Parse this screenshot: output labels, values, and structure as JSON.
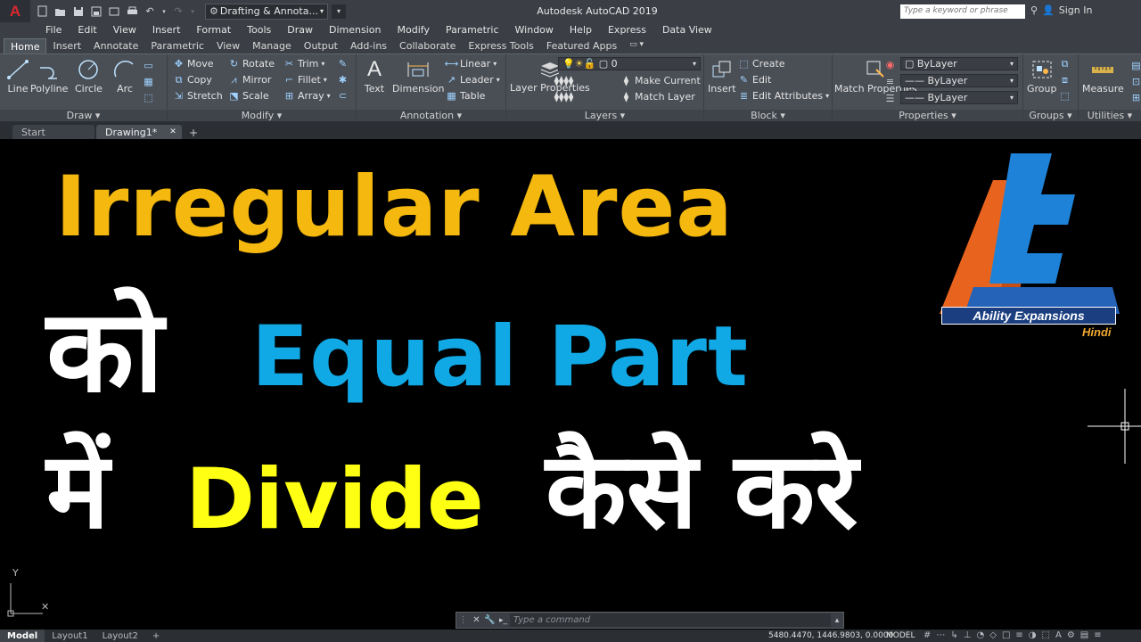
{
  "titlebar": {
    "logo": "A",
    "workspace": "Drafting & Annota...",
    "title": "Autodesk AutoCAD 2019",
    "search_placeholder": "Type a keyword or phrase",
    "signin": "Sign In"
  },
  "menu": [
    "File",
    "Edit",
    "View",
    "Insert",
    "Format",
    "Tools",
    "Draw",
    "Dimension",
    "Modify",
    "Parametric",
    "Window",
    "Help",
    "Express",
    "Data View"
  ],
  "ribbon_tabs": [
    "Home",
    "Insert",
    "Annotate",
    "Parametric",
    "View",
    "Manage",
    "Output",
    "Add-ins",
    "Collaborate",
    "Express Tools",
    "Featured Apps"
  ],
  "ribbon": {
    "draw": {
      "label": "Draw",
      "line": "Line",
      "polyline": "Polyline",
      "circle": "Circle",
      "arc": "Arc"
    },
    "modify": {
      "label": "Modify",
      "move": "Move",
      "rotate": "Rotate",
      "trim": "Trim",
      "copy": "Copy",
      "mirror": "Mirror",
      "fillet": "Fillet",
      "stretch": "Stretch",
      "scale": "Scale",
      "array": "Array"
    },
    "annotation": {
      "label": "Annotation",
      "text": "Text",
      "dimension": "Dimension",
      "linear": "Linear",
      "leader": "Leader",
      "table": "Table"
    },
    "layers": {
      "label": "Layers",
      "layer_properties": "Layer Properties",
      "layer_value": "0",
      "make_current": "Make Current",
      "match_layer": "Match Layer"
    },
    "block": {
      "label": "Block",
      "insert": "Insert",
      "create": "Create",
      "edit": "Edit",
      "edit_attributes": "Edit Attributes"
    },
    "properties": {
      "label": "Properties",
      "match_properties": "Match Properties",
      "color": "ByLayer",
      "linetype": "ByLayer",
      "lineweight": "ByLayer"
    },
    "groups": {
      "label": "Groups",
      "group": "Group"
    },
    "utilities": {
      "label": "Utilities",
      "measure": "Measure"
    }
  },
  "file_tabs": {
    "start": "Start",
    "drawing": "Drawing1*",
    "add": "+"
  },
  "canvas": {
    "line1": "Irregular Area",
    "line2a": "को",
    "line2b": "Equal Part",
    "line3a": "में",
    "line3b": "Divide",
    "line3c": "कैसे करे",
    "logo_line1": "Ability Expansions",
    "logo_line2": "Hindi",
    "ucs_y": "Y",
    "colors": {
      "orange": "#f5b80f",
      "blue": "#10a9e6",
      "yellow": "#ffff14",
      "white": "#ffffff",
      "logo_orange": "#e8641e",
      "logo_blue": "#1e82d8"
    }
  },
  "command": {
    "placeholder": "Type a command"
  },
  "status": {
    "layouts": [
      "Model",
      "Layout1",
      "Layout2"
    ],
    "add": "+",
    "coords": "5480.4470, 1446.9803, 0.0000",
    "model": "MODEL"
  }
}
